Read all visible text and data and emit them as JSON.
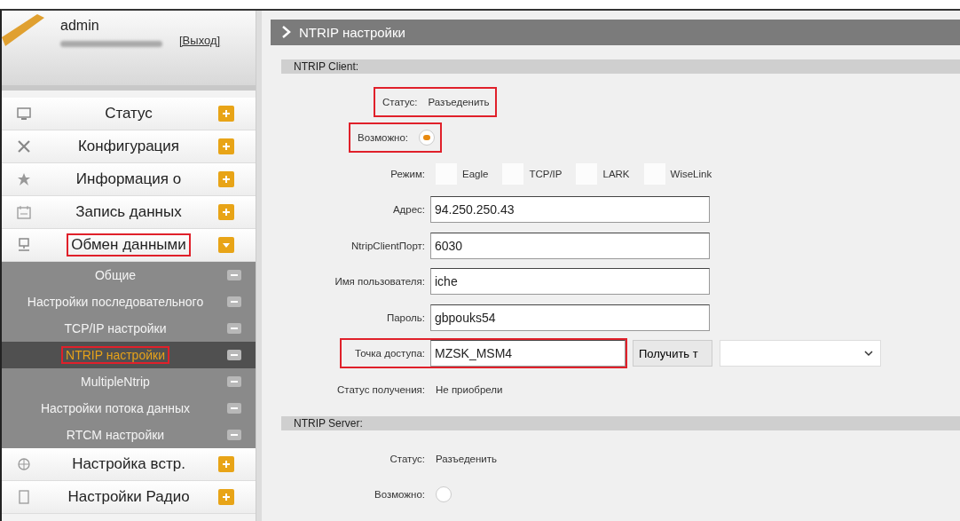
{
  "user": {
    "name": "admin",
    "logout": "[Выход]"
  },
  "menu": [
    {
      "label": "Статус",
      "expanded": false,
      "highlighted": false
    },
    {
      "label": "Конфигурация",
      "expanded": false,
      "highlighted": false
    },
    {
      "label": "Информация о",
      "expanded": false,
      "highlighted": false
    },
    {
      "label": "Запись данных",
      "expanded": false,
      "highlighted": false
    },
    {
      "label": "Обмен данными",
      "expanded": true,
      "highlighted": true,
      "children": [
        {
          "label": "Общие",
          "selected": false,
          "highlighted": false
        },
        {
          "label": "Настройки последовательного",
          "selected": false,
          "highlighted": false
        },
        {
          "label": "TCP/IP настройки",
          "selected": false,
          "highlighted": false
        },
        {
          "label": "NTRIP настройки",
          "selected": true,
          "highlighted": true
        },
        {
          "label": "MultipleNtrip",
          "selected": false,
          "highlighted": false
        },
        {
          "label": "Настройки потока данных",
          "selected": false,
          "highlighted": false
        },
        {
          "label": "RTCM настройки",
          "selected": false,
          "highlighted": false
        }
      ]
    },
    {
      "label": "Настройка встр.",
      "expanded": false,
      "highlighted": false
    },
    {
      "label": "Настройки Радио",
      "expanded": false,
      "highlighted": false
    }
  ],
  "page_title": "NTRIP настройки",
  "sections": [
    {
      "title": "NTRIP Client:",
      "fields": [
        {
          "kind": "text",
          "label": "Статус:",
          "value": "Разъеденить",
          "highlighted": true
        },
        {
          "kind": "radio",
          "label": "Возможно:",
          "checked": true,
          "highlighted": true
        },
        {
          "kind": "options",
          "label": "Режим:",
          "options": [
            {
              "label": "Eagle",
              "checked": false
            },
            {
              "label": "TCP/IP",
              "checked": false
            },
            {
              "label": "LARK",
              "checked": false
            },
            {
              "label": "WiseLink",
              "checked": false
            }
          ]
        },
        {
          "kind": "input",
          "label": "Адрес:",
          "value": "94.250.250.43"
        },
        {
          "kind": "input",
          "label": "NtripClientПорт:",
          "value": "6030"
        },
        {
          "kind": "input",
          "label": "Имя пользователя:",
          "value": "iche"
        },
        {
          "kind": "input",
          "label": "Пароль:",
          "value": "gbpouks54"
        },
        {
          "kind": "fetch",
          "label": "Точка доступа:",
          "value": "MZSK_MSM4",
          "button": "Получить т",
          "highlighted": true
        },
        {
          "kind": "text",
          "label": "Статус получения:",
          "value": "Не приобрели",
          "highlighted": false
        }
      ]
    },
    {
      "title": "NTRIP Server:",
      "fields": [
        {
          "kind": "text",
          "label": "Статус:",
          "value": "Разъеденить",
          "highlighted": false
        },
        {
          "kind": "radio",
          "label": "Возможно:",
          "checked": false,
          "highlighted": false
        }
      ]
    }
  ]
}
